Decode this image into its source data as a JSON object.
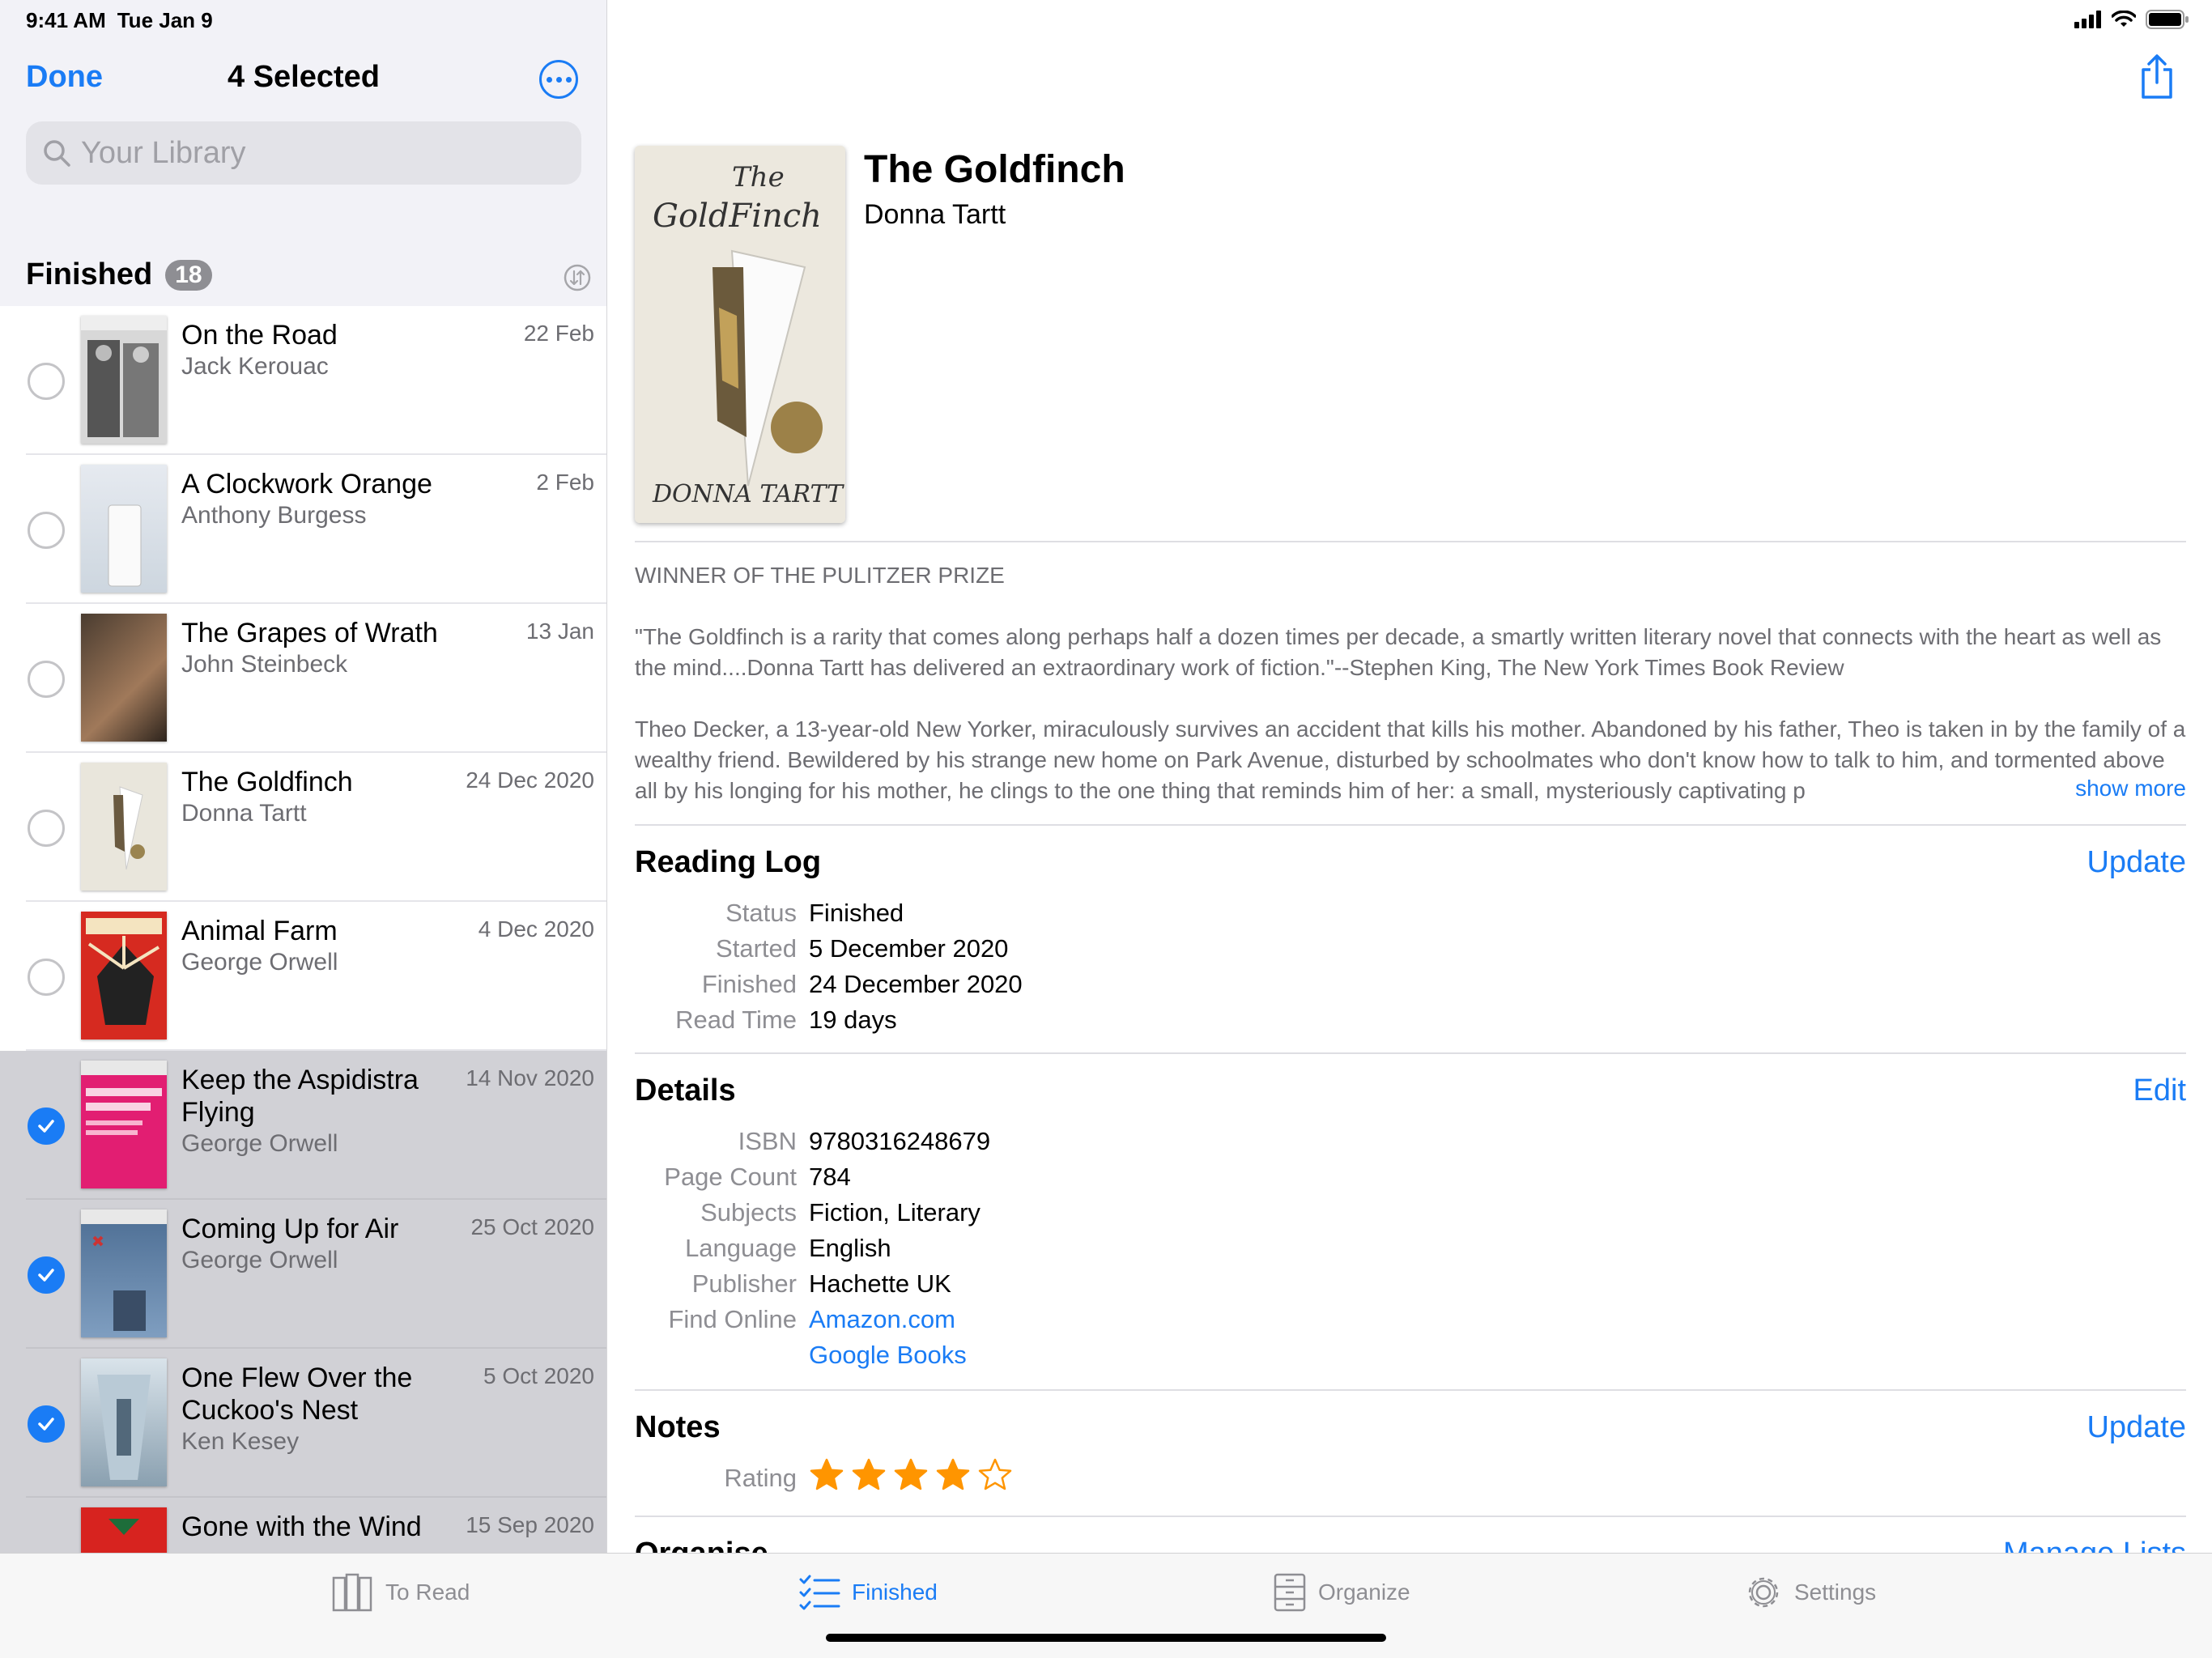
{
  "status_bar": {
    "time": "9:41 AM",
    "date": "Tue Jan 9"
  },
  "sidebar": {
    "done_label": "Done",
    "title": "4 Selected",
    "search_placeholder": "Your Library",
    "section_title": "Finished",
    "section_count": "18",
    "books": [
      {
        "title": "On the Road",
        "author": "Jack Kerouac",
        "date": "22 Feb",
        "selected": false
      },
      {
        "title": "A Clockwork Orange",
        "author": "Anthony Burgess",
        "date": "2 Feb",
        "selected": false
      },
      {
        "title": "The Grapes of Wrath",
        "author": "John Steinbeck",
        "date": "13 Jan",
        "selected": false
      },
      {
        "title": "The Goldfinch",
        "author": "Donna Tartt",
        "date": "24 Dec 2020",
        "selected": false
      },
      {
        "title": "Animal Farm",
        "author": "George Orwell",
        "date": "4 Dec 2020",
        "selected": false
      },
      {
        "title": "Keep the Aspidistra Flying",
        "author": "George Orwell",
        "date": "14 Nov 2020",
        "selected": true
      },
      {
        "title": "Coming Up for Air",
        "author": "George Orwell",
        "date": "25 Oct 2020",
        "selected": true
      },
      {
        "title": "One Flew Over the Cuckoo's Nest",
        "author": "Ken Kesey",
        "date": "5 Oct 2020",
        "selected": true
      },
      {
        "title": "Gone with the Wind",
        "author": "",
        "date": "15 Sep 2020",
        "selected": true
      }
    ]
  },
  "detail": {
    "title": "The Goldfinch",
    "author": "Donna Tartt",
    "tagline": "WINNER OF THE PULITZER PRIZE",
    "quote": "\"The Goldfinch is a rarity that comes along perhaps half a dozen times per decade, a smartly written literary novel that connects with the heart as well as the mind....Donna Tartt has delivered an extraordinary work of fiction.\"--Stephen King, The New York Times Book Review",
    "description": "Theo Decker, a 13-year-old New Yorker, miraculously survives an accident that kills his mother. Abandoned by his father, Theo is taken in by the family of a wealthy friend. Bewildered by his strange new home on Park Avenue, disturbed by schoolmates who don't know how to talk to him, and tormented above all by his longing for his mother, he clings to the one thing that reminds him of her: a small, mysteriously captivating p",
    "show_more": "show more",
    "reading_log": {
      "title": "Reading Log",
      "action": "Update",
      "rows": [
        {
          "key": "Status",
          "value": "Finished"
        },
        {
          "key": "Started",
          "value": "5 December 2020"
        },
        {
          "key": "Finished",
          "value": "24 December 2020"
        },
        {
          "key": "Read Time",
          "value": "19 days"
        }
      ]
    },
    "details": {
      "title": "Details",
      "action": "Edit",
      "rows": [
        {
          "key": "ISBN",
          "value": "9780316248679"
        },
        {
          "key": "Page Count",
          "value": "784"
        },
        {
          "key": "Subjects",
          "value": "Fiction, Literary"
        },
        {
          "key": "Language",
          "value": "English"
        },
        {
          "key": "Publisher",
          "value": "Hachette UK"
        },
        {
          "key": "Find Online",
          "value": "Amazon.com"
        },
        {
          "key": "",
          "value": "Google Books"
        }
      ]
    },
    "notes": {
      "title": "Notes",
      "action": "Update",
      "rating_label": "Rating",
      "rating": 4,
      "rating_max": 5
    },
    "organise": {
      "title": "Organise",
      "action": "Manage Lists"
    }
  },
  "tabbar": {
    "tabs": [
      {
        "label": "To Read",
        "icon": "books-icon",
        "active": false
      },
      {
        "label": "Finished",
        "icon": "checklist-icon",
        "active": true
      },
      {
        "label": "Organize",
        "icon": "cabinet-icon",
        "active": false
      },
      {
        "label": "Settings",
        "icon": "gear-icon",
        "active": false
      }
    ]
  },
  "colors": {
    "accent": "#1a7cf5",
    "star": "#ff9500",
    "selected_row": "#d1d1d6"
  }
}
